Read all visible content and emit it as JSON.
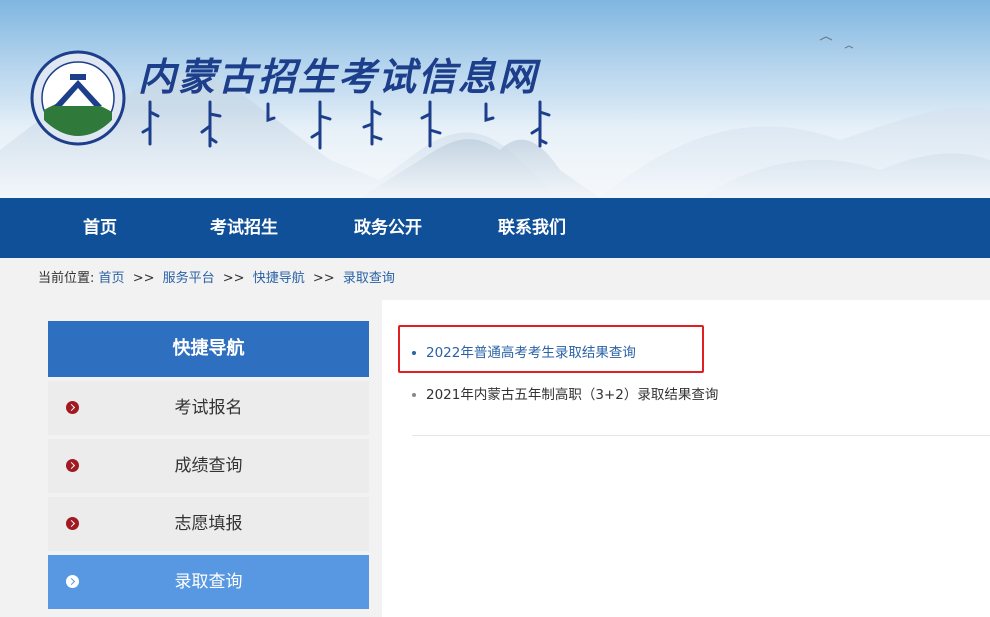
{
  "banner": {
    "title": "内蒙古招生考试信息网",
    "colors": {
      "title": "#1d3e8a",
      "sky": "#7fb6e0"
    }
  },
  "nav": {
    "items": [
      "首页",
      "考试招生",
      "政务公开",
      "联系我们"
    ],
    "background": "#0f5099"
  },
  "breadcrumb": {
    "label": "当前位置:",
    "items": [
      "首页",
      "服务平台",
      "快捷导航",
      "录取查询"
    ],
    "separator": ">>"
  },
  "sidebar": {
    "header": "快捷导航",
    "items": [
      {
        "label": "考试报名",
        "active": false
      },
      {
        "label": "成绩查询",
        "active": false
      },
      {
        "label": "志愿填报",
        "active": false
      },
      {
        "label": "录取查询",
        "active": true
      }
    ],
    "accent": "#2f6fbf",
    "active_color": "#5898e2",
    "bullet_color": "#a11a22"
  },
  "main": {
    "links": [
      "2022年普通高考考生录取结果查询",
      "2021年内蒙古五年制高职（3+2）录取结果查询"
    ],
    "highlight_color": "#e02020"
  },
  "icons": [
    "logo-emblem",
    "chevron-right-icon",
    "list-dot-icon"
  ]
}
